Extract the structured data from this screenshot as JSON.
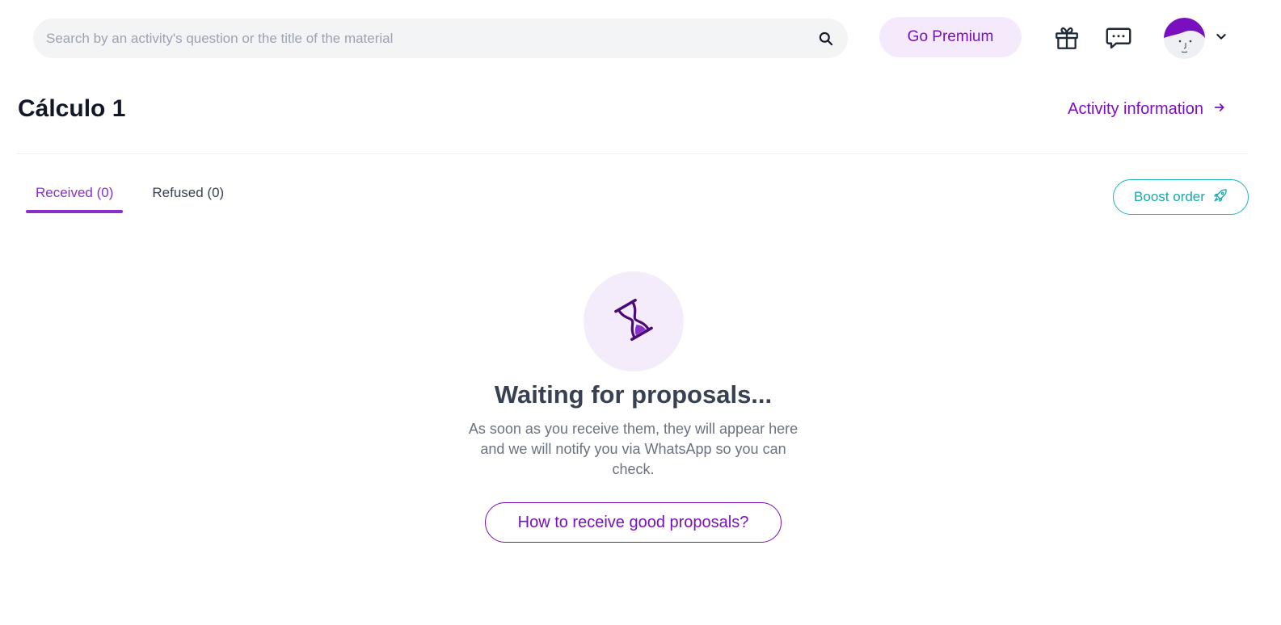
{
  "header": {
    "search": {
      "placeholder": "Search by an activity's question or the title of the material",
      "value": ""
    },
    "premium_label": "Go Premium",
    "icons": {
      "search": "search-icon",
      "gift": "gift-icon",
      "chat": "chat-icon",
      "chevron": "chevron-down-icon"
    }
  },
  "page": {
    "title": "Cálculo 1",
    "activity_info_label": "Activity information"
  },
  "tabs": [
    {
      "label": "Received (0)",
      "active": true
    },
    {
      "label": "Refused (0)",
      "active": false
    }
  ],
  "boost": {
    "label": "Boost order",
    "icon": "rocket-icon"
  },
  "empty_state": {
    "icon": "hourglass-icon",
    "title": "Waiting for proposals...",
    "description": "As soon as you receive them, they will appear here and we will notify you via WhatsApp so you can check.",
    "button_label": "How to receive good proposals?"
  },
  "colors": {
    "accent": "#7a0fbf",
    "tab_active": "#8b2fc9",
    "premium_bg": "#f4eafc",
    "teal": "#16a9ad",
    "search_bg": "#f3f4f6"
  }
}
